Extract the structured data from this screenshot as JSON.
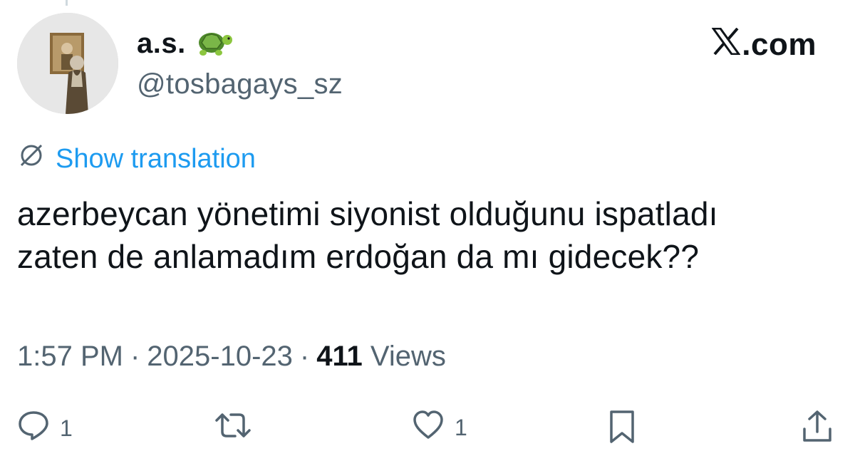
{
  "author": {
    "display_name": "a.s.",
    "emoji_icon": "turtle-emoji",
    "handle": "@tosbagays_sz"
  },
  "brand": {
    "label": ".com",
    "icon": "x-logo-icon"
  },
  "translation": {
    "label": "Show translation",
    "icon": "globe-icon"
  },
  "tweet": {
    "lines": [
      "azerbeycan yönetimi siyonist olduğunu ispatladı",
      "zaten de anlamadım erdoğan da mı gidecek??"
    ]
  },
  "meta": {
    "time": "1:57 PM",
    "separator": "·",
    "date": "2025-10-23",
    "views_count": "411",
    "views_label": "Views"
  },
  "actions": {
    "reply_count": "1",
    "like_count": "1"
  },
  "colors": {
    "accent": "#1d9bf0",
    "text_primary": "#0f1419",
    "text_secondary": "#536471"
  }
}
